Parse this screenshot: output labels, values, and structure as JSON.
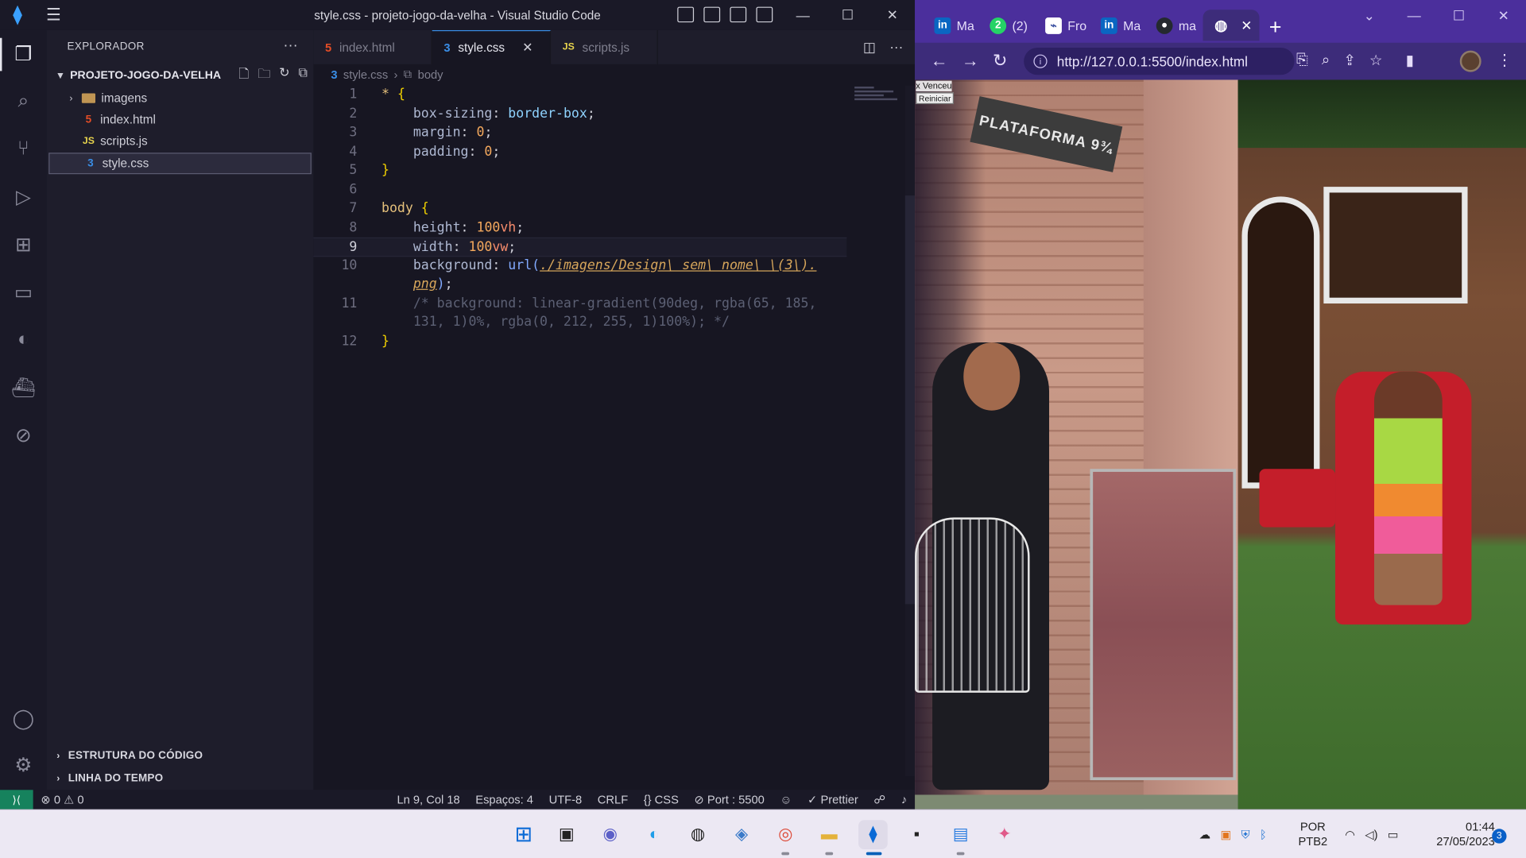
{
  "vscode": {
    "window_title": "style.css - projeto-jogo-da-velha - Visual Studio Code",
    "sidebar": {
      "header": "EXPLORADOR",
      "project": "PROJETO-JOGO-DA-VELHA",
      "tree": [
        {
          "label": "imagens",
          "type": "folder"
        },
        {
          "label": "index.html",
          "type": "html"
        },
        {
          "label": "scripts.js",
          "type": "js"
        },
        {
          "label": "style.css",
          "type": "css",
          "selected": true
        }
      ],
      "sections": [
        "ESTRUTURA DO CÓDIGO",
        "LINHA DO TEMPO"
      ]
    },
    "tabs": [
      {
        "label": "index.html",
        "icon": "html-file-icon",
        "badge": "5"
      },
      {
        "label": "style.css",
        "icon": "css-file-icon",
        "badge": "3",
        "active": true
      },
      {
        "label": "scripts.js",
        "icon": "js-file-icon",
        "badge": "JS"
      }
    ],
    "breadcrumb": {
      "file": "style.css",
      "symbol": "body"
    },
    "code_lines": [
      {
        "n": "1",
        "text": "* {"
      },
      {
        "n": "2",
        "text": "    box-sizing: border-box;"
      },
      {
        "n": "3",
        "text": "    margin: 0;"
      },
      {
        "n": "4",
        "text": "    padding: 0;"
      },
      {
        "n": "5",
        "text": "}"
      },
      {
        "n": "6",
        "text": ""
      },
      {
        "n": "7",
        "text": "body {"
      },
      {
        "n": "8",
        "text": "    height: 100vh;"
      },
      {
        "n": "9",
        "text": "    width: 100vw;"
      },
      {
        "n": "10",
        "text": "    background: url(./imagens/Design\\ sem\\ nome\\ \\(3\\)."
      },
      {
        "n": "",
        "text": "    png);"
      },
      {
        "n": "11",
        "text": "    /* background: linear-gradient(90deg, rgba(65, 185,"
      },
      {
        "n": "",
        "text": "    131, 1)0%, rgba(0, 212, 255, 1)100%); */"
      },
      {
        "n": "12",
        "text": "}"
      }
    ],
    "status": {
      "errors": "0",
      "warnings": "0",
      "position": "Ln 9, Col 18",
      "spaces": "Espaços: 4",
      "encoding": "UTF-8",
      "eol": "CRLF",
      "language": "CSS",
      "port": "Port : 5500",
      "formatter": "Prettier"
    }
  },
  "chrome": {
    "tabs": [
      {
        "label": "Ma",
        "icon": "linkedin-icon",
        "fav_text": "in"
      },
      {
        "label": "(2)",
        "icon": "whatsapp-icon",
        "fav_text": "2"
      },
      {
        "label": "Fro",
        "icon": "frontend-mentor-icon",
        "fav_text": ""
      },
      {
        "label": "Ma",
        "icon": "linkedin-icon",
        "fav_text": "in"
      },
      {
        "label": "ma",
        "icon": "github-icon",
        "fav_text": ""
      },
      {
        "label": "",
        "icon": "globe-icon",
        "fav_text": "",
        "active": true
      }
    ],
    "url": "http://127.0.0.1:5500/index.html",
    "page": {
      "result_text": "x Venceu",
      "restart_button": "Reiniciar",
      "sign_text": "PLATAFORMA 9¾"
    }
  },
  "taskbar": {
    "apps": [
      "windows-start-icon",
      "task-view-icon",
      "teams-chat-icon",
      "edge-icon",
      "app-icon",
      "network-app-icon",
      "chrome-icon",
      "file-explorer-icon",
      "vscode-icon",
      "terminal-icon",
      "notepad-icon",
      "app-icon"
    ],
    "lang_line1": "POR",
    "lang_line2": "PTB2",
    "time": "01:44",
    "date": "27/05/2023",
    "notification_count": "3"
  },
  "colors": {
    "vscode_bg": "#1e1d2b",
    "editor_bg": "#171622",
    "accent_blue": "#3a8ee6",
    "chrome_purple": "#4b2f9c",
    "taskbar_bg": "#ece8f3"
  }
}
